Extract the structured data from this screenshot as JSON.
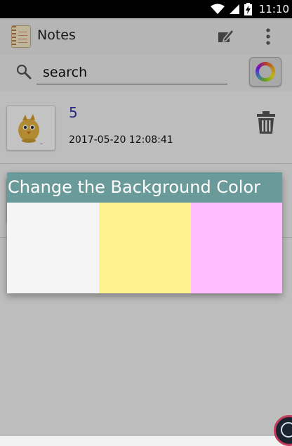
{
  "status_bar": {
    "time": "11:10"
  },
  "app_bar": {
    "title": "Notes",
    "app_icon": "notes-app-icon",
    "compose_icon": "compose-icon",
    "menu_icon": "more-vert-icon"
  },
  "search": {
    "value": "search",
    "icon": "search-icon",
    "color_button_icon": "color-wheel-icon"
  },
  "notes": [
    {
      "title": "5",
      "date": "2017-05-20 12:08:41",
      "thumbnail": "chick-image",
      "delete_icon": "trash-icon"
    },
    {
      "title": "",
      "date": "",
      "thumbnail": "image-thumbnail"
    }
  ],
  "dialog": {
    "title": "Change the Background Color",
    "colors": [
      "#f5f5f5",
      "#fff28e",
      "#ffbdff"
    ]
  },
  "colors": {
    "header": "#6b9a9a",
    "note_title": "#3333aa"
  }
}
